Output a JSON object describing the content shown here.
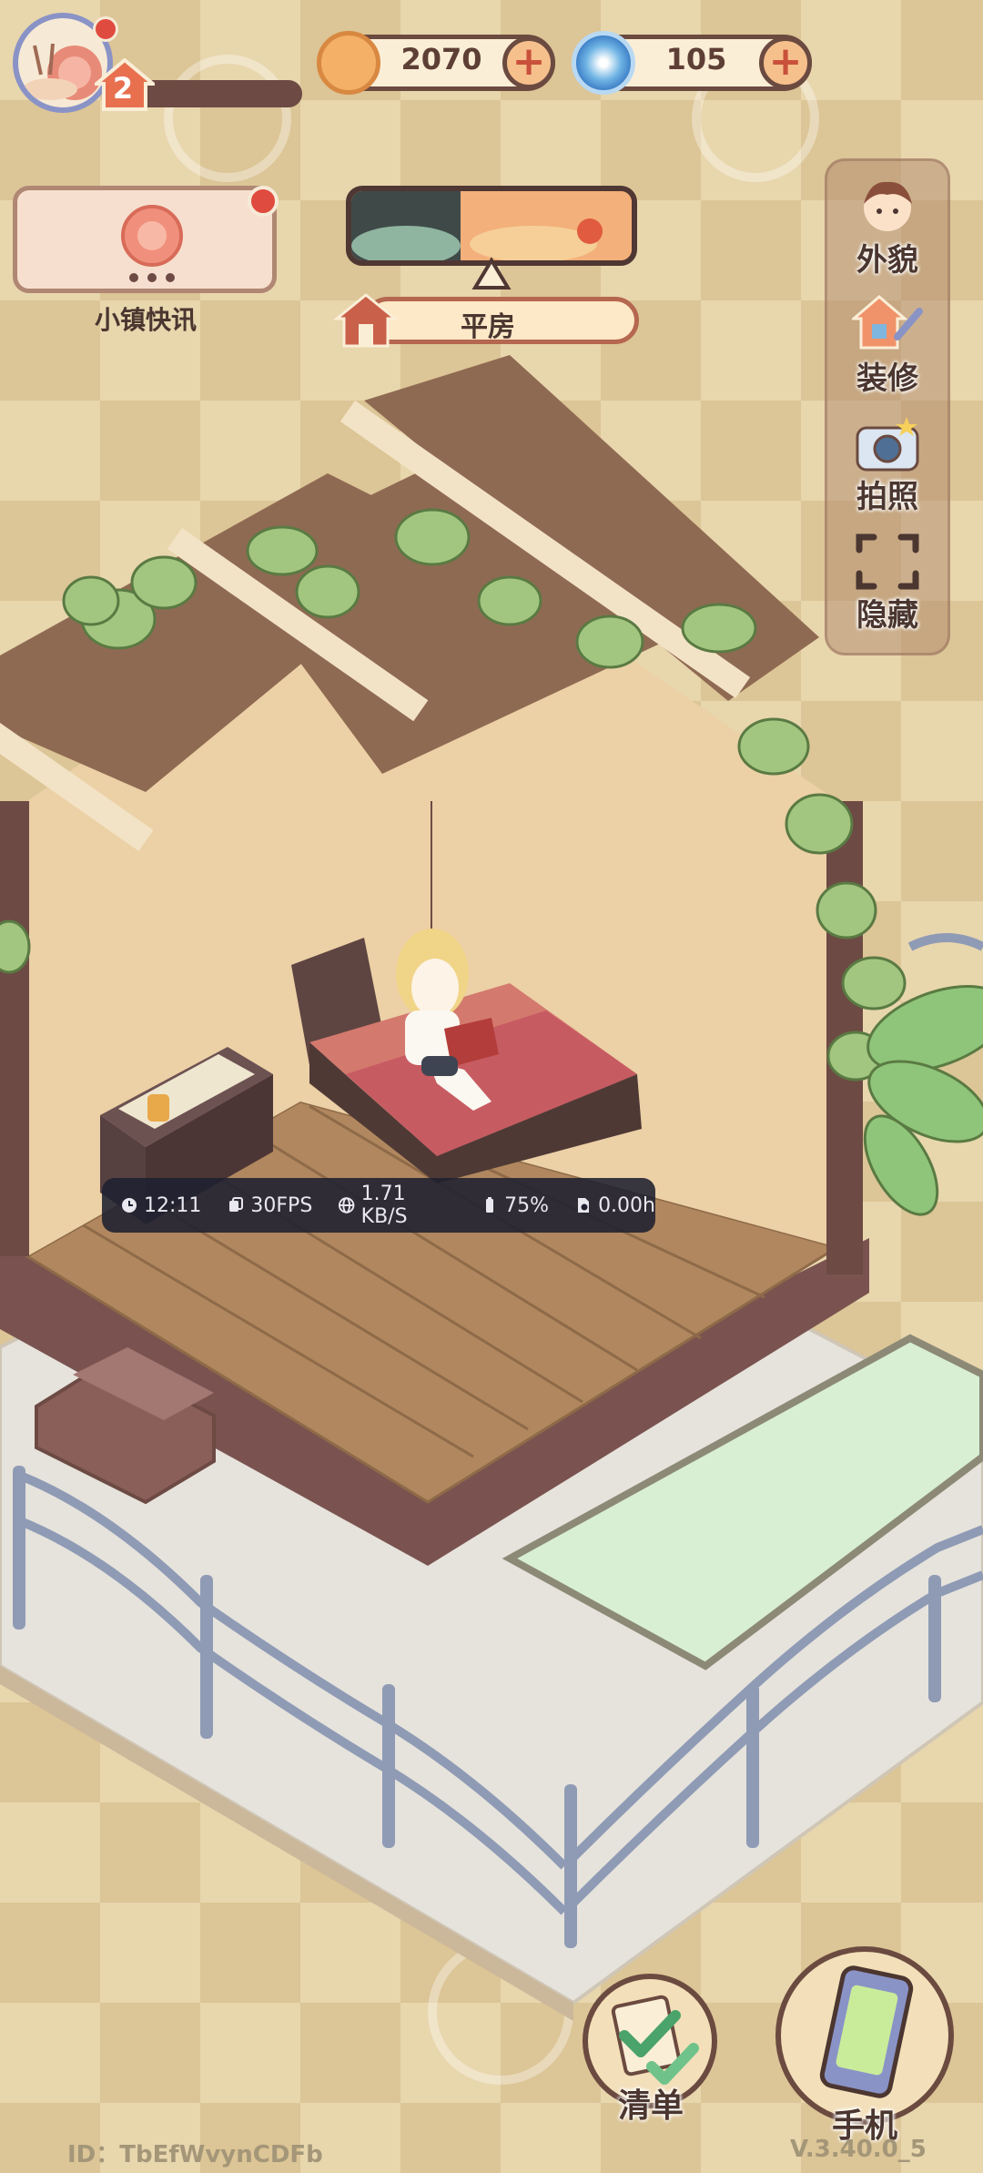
{
  "player": {
    "level": "2",
    "has_notification": true
  },
  "resources": {
    "coins": {
      "value": "2070",
      "icon": "coin-icon"
    },
    "gems": {
      "value": "105",
      "icon": "swirl-gem-icon"
    }
  },
  "news": {
    "label": "小镇快讯",
    "icon": "snail-shell-icon",
    "has_notification": true
  },
  "weather": {
    "icon": "sunset-weather-icon",
    "house_type": "平房",
    "house_icon": "house-icon"
  },
  "side_menu": [
    {
      "label": "外貌",
      "icon": "character-face-icon"
    },
    {
      "label": "装修",
      "icon": "house-wrench-icon"
    },
    {
      "label": "拍照",
      "icon": "camera-icon"
    },
    {
      "label": "隐藏",
      "icon": "fullscreen-frame-icon"
    }
  ],
  "stats": {
    "time": "12:11",
    "fps": "30FPS",
    "network": "1.71 KB/S",
    "battery": "75%",
    "hours": "0.00h"
  },
  "bottom": {
    "checklist_label": "清单",
    "phone_label": "手机"
  },
  "footer": {
    "id_text": "ID：TbEfWvynCDFb",
    "version": "V.3.40.0_5"
  },
  "colors": {
    "background": "#e8d6ad",
    "panel_border": "#6b4a40",
    "accent_red": "#e04b3f",
    "text_dark": "#4b3630"
  }
}
